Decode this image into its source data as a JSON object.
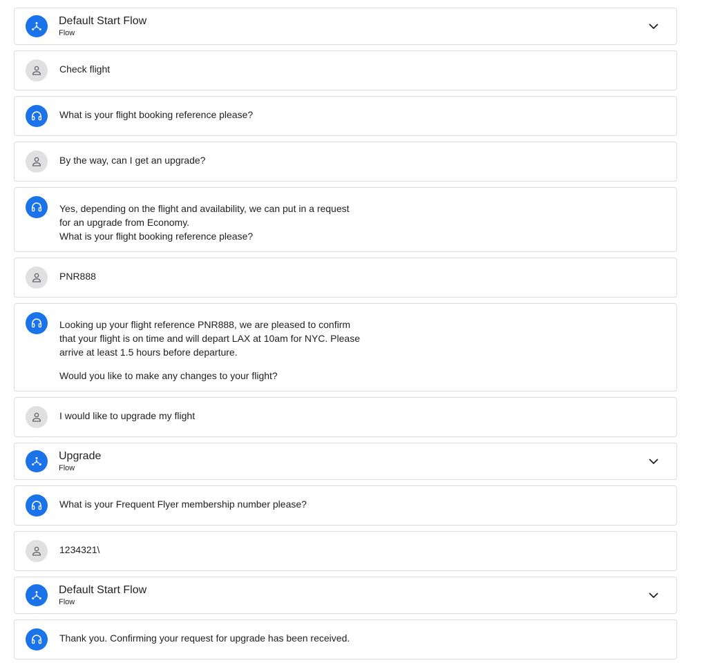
{
  "colors": {
    "agent_accent": "#1a73e8",
    "user_avatar_bg": "#e0e0e0",
    "border": "#dadce0"
  },
  "icons": {
    "flow": "flow-branch-icon",
    "agent": "headset-icon",
    "user": "person-icon",
    "expand": "chevron-down-icon"
  },
  "conversation": [
    {
      "kind": "flow",
      "title": "Default Start Flow",
      "subtitle": "Flow"
    },
    {
      "kind": "user",
      "lines": [
        "Check flight"
      ]
    },
    {
      "kind": "agent",
      "lines": [
        "What is your flight booking reference please?"
      ]
    },
    {
      "kind": "user",
      "lines": [
        "By the way, can I get an upgrade?"
      ]
    },
    {
      "kind": "agent",
      "lines": [
        "Yes, depending on the flight and availability, we can put in a request\nfor an upgrade from Economy.\nWhat is your flight booking reference please?"
      ]
    },
    {
      "kind": "user",
      "lines": [
        "PNR888"
      ]
    },
    {
      "kind": "agent",
      "lines": [
        "Looking up your flight reference PNR888, we are pleased to confirm\nthat your flight is on time and will depart LAX at 10am for NYC.  Please\narrive at least 1.5 hours before departure.",
        "Would you like to make any changes to your flight?"
      ]
    },
    {
      "kind": "user",
      "lines": [
        "I would like to upgrade my flight"
      ]
    },
    {
      "kind": "flow",
      "title": "Upgrade",
      "subtitle": "Flow"
    },
    {
      "kind": "agent",
      "lines": [
        "What is your Frequent Flyer membership number please?"
      ]
    },
    {
      "kind": "user",
      "lines": [
        "1234321\\"
      ]
    },
    {
      "kind": "flow",
      "title": "Default Start Flow",
      "subtitle": "Flow"
    },
    {
      "kind": "agent",
      "lines": [
        "Thank you.  Confirming your request for upgrade has been received."
      ]
    }
  ]
}
